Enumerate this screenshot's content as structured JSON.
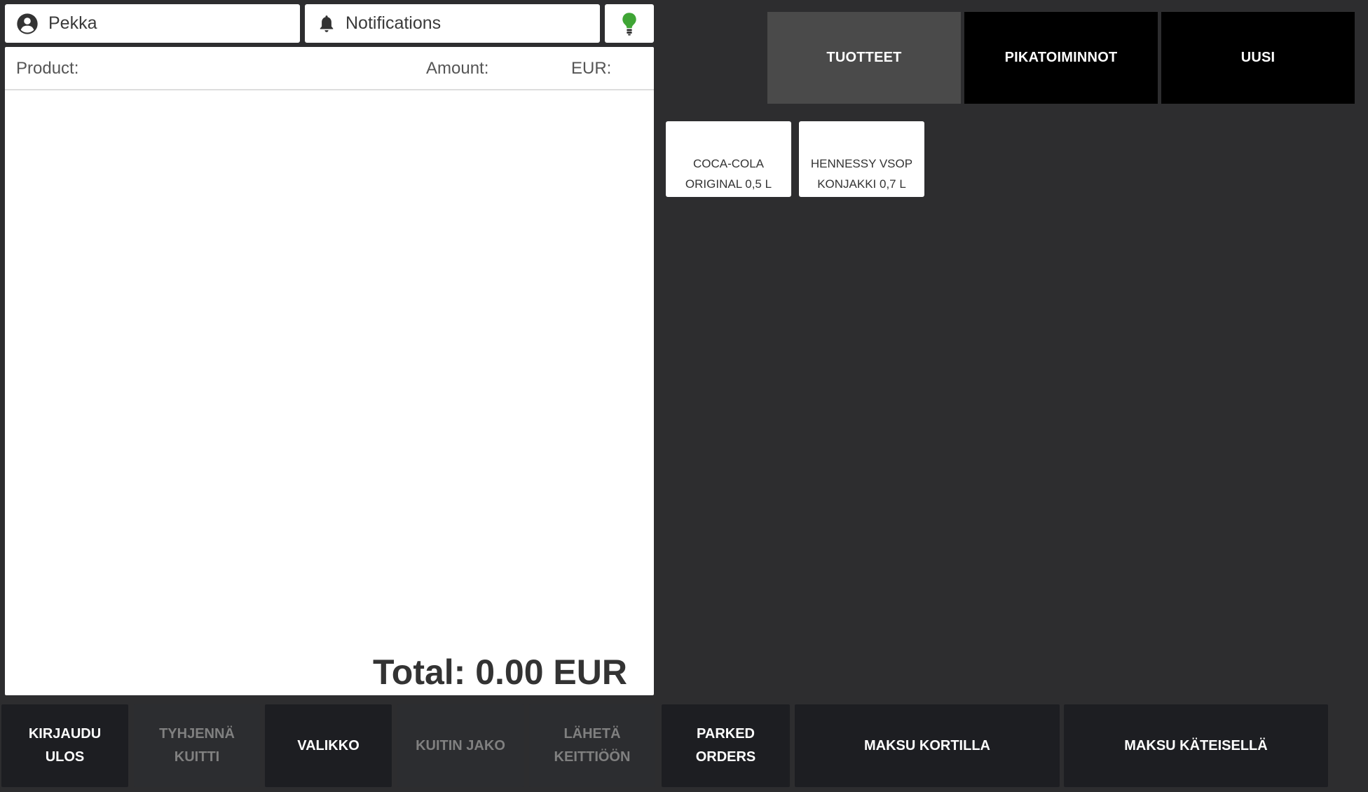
{
  "topbar": {
    "user_name": "Pekka",
    "notifications_label": "Notifications",
    "status_color": "#3fa535"
  },
  "receipt": {
    "columns": {
      "product": "Product:",
      "amount": "Amount:",
      "currency": "EUR:"
    },
    "lines": [],
    "total_label": "Total: 0.00 EUR"
  },
  "tabs": [
    {
      "label": "TUOTTEET",
      "active": true
    },
    {
      "label": "PIKATOIMINNOT",
      "active": false
    },
    {
      "label": "UUSI",
      "active": false
    }
  ],
  "products": [
    {
      "line1": "COCA-COLA",
      "line2": "ORIGINAL 0,5 L"
    },
    {
      "line1": "HENNESSY VSOP",
      "line2": "KONJAKKI 0,7 L"
    }
  ],
  "actions": [
    {
      "label": "KIRJAUDU ULOS",
      "enabled": true
    },
    {
      "label": "TYHJENNÄ KUITTI",
      "enabled": false
    },
    {
      "label": "VALIKKO",
      "enabled": true
    },
    {
      "label": "KUITIN JAKO",
      "enabled": false
    },
    {
      "label": "LÄHETÄ KEITTIÖÖN",
      "enabled": false
    },
    {
      "label": "PARKED ORDERS",
      "enabled": true
    },
    {
      "label": "MAKSU KORTILLA",
      "enabled": true
    },
    {
      "label": "MAKSU KÄTEISELLÄ",
      "enabled": true
    }
  ]
}
